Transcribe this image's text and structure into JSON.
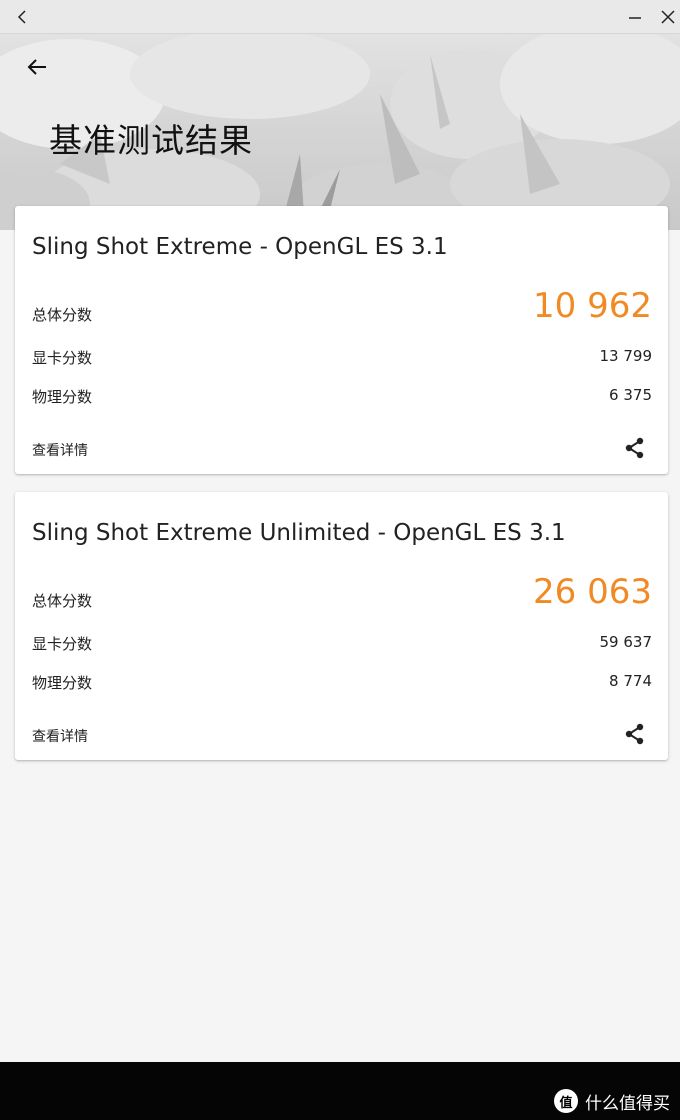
{
  "page": {
    "title": "基准测试结果"
  },
  "cards": [
    {
      "title": "Sling Shot Extreme - OpenGL ES 3.1",
      "total_label": "总体分数",
      "total_value": "10 962",
      "graphics_label": "显卡分数",
      "graphics_value": "13 799",
      "physics_label": "物理分数",
      "physics_value": "6 375",
      "details_label": "查看详情"
    },
    {
      "title": "Sling Shot Extreme Unlimited - OpenGL ES 3.1",
      "total_label": "总体分数",
      "total_value": "26 063",
      "graphics_label": "显卡分数",
      "graphics_value": "59 637",
      "physics_label": "物理分数",
      "physics_value": "8 774",
      "details_label": "查看详情"
    }
  ],
  "watermark": {
    "logo_glyph": "值",
    "text": "什么值得买"
  },
  "colors": {
    "score_accent": "#f08a24",
    "card_bg": "#ffffff",
    "page_bg": "#f5f5f5"
  },
  "icons": [
    "window-back-icon",
    "window-minimize-icon",
    "window-close-icon",
    "back-arrow-icon",
    "share-icon"
  ]
}
